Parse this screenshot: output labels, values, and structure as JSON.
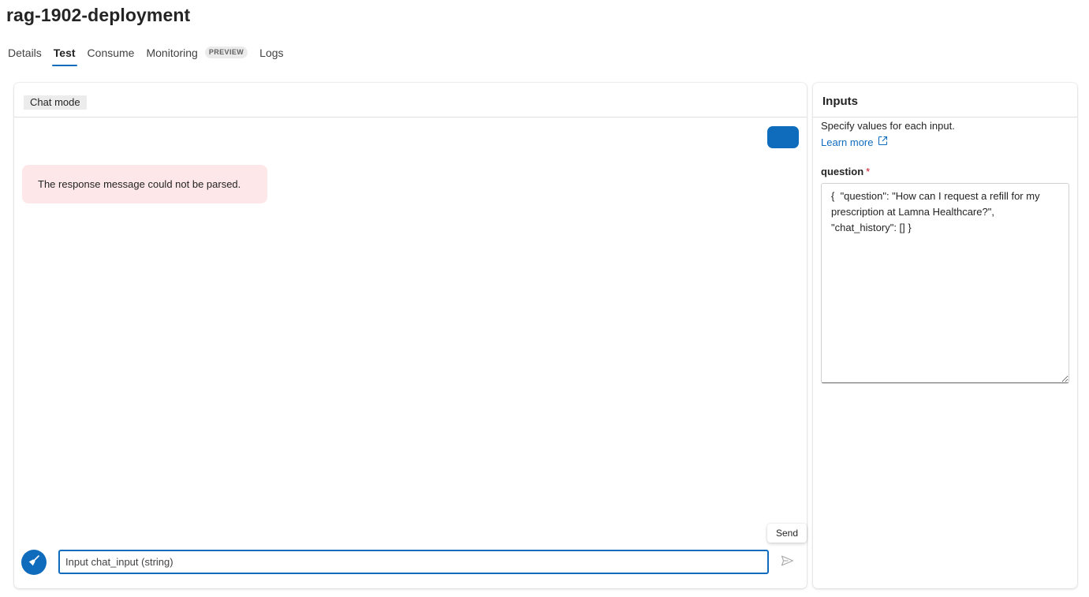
{
  "page": {
    "title": "rag-1902-deployment"
  },
  "tabs": [
    {
      "label": "Details"
    },
    {
      "label": "Test",
      "active": true
    },
    {
      "label": "Consume"
    },
    {
      "label": "Monitoring",
      "badge": "PREVIEW"
    },
    {
      "label": "Logs"
    }
  ],
  "chat": {
    "mode_label": "Chat mode",
    "error_message": "The response message could not be parsed.",
    "input_placeholder": "Input chat_input (string)",
    "send_tooltip": "Send",
    "icons": {
      "clear": "broom-icon",
      "send": "send-icon"
    }
  },
  "inputs": {
    "title": "Inputs",
    "description": "Specify values for each input.",
    "learn_more": "Learn more",
    "field": {
      "label": "question",
      "required_mark": "*",
      "value": "{  \"question\": \"How can I request a refill for my prescription at Lamna Healthcare?\", \"chat_history\": [] }"
    }
  },
  "colors": {
    "accent": "#0f6cbd",
    "error_bg": "#fde7e9",
    "required": "#c50f1f"
  }
}
